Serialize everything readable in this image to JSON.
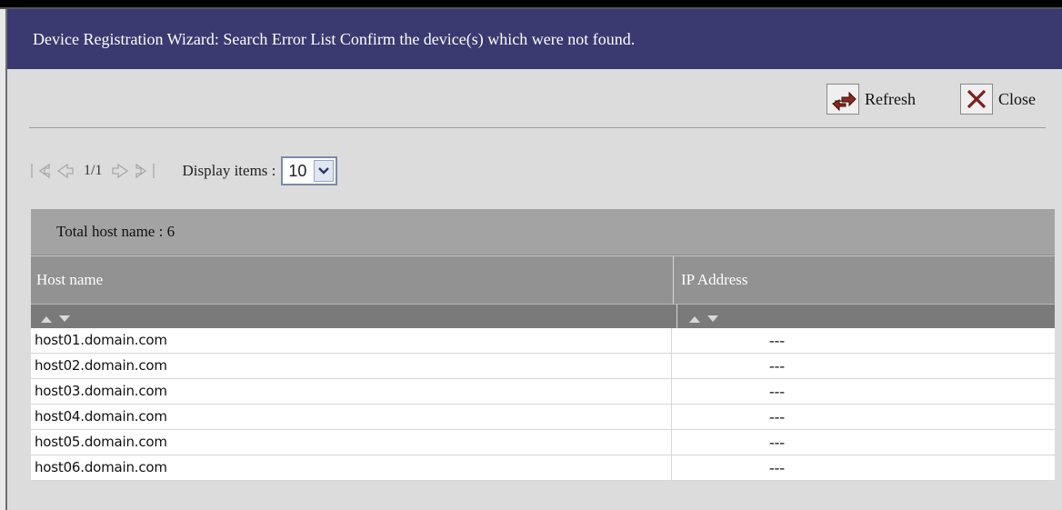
{
  "window": {
    "title": "Device Registration Wizard: Search Error List Confirm the device(s) which were not found."
  },
  "toolbar": {
    "refresh_label": "Refresh",
    "close_label": "Close",
    "refresh_icon": "refresh-icon",
    "close_icon": "close-icon"
  },
  "pager": {
    "page_text": "1/1",
    "display_items_label": "Display items :",
    "display_items_value": "10"
  },
  "grid": {
    "total_label": "Total host name : 6",
    "columns": [
      "Host name",
      "IP Address"
    ],
    "rows": [
      {
        "host": "host01.domain.com",
        "ip": "---"
      },
      {
        "host": "host02.domain.com",
        "ip": "---"
      },
      {
        "host": "host03.domain.com",
        "ip": "---"
      },
      {
        "host": "host04.domain.com",
        "ip": "---"
      },
      {
        "host": "host05.domain.com",
        "ip": "---"
      },
      {
        "host": "host06.domain.com",
        "ip": "---"
      }
    ]
  },
  "colors": {
    "title_bar": "#3a3970",
    "panel": "#dcdcdc",
    "close_x": "#7a1f1f",
    "refresh_arrows": "#8b2a1e"
  }
}
